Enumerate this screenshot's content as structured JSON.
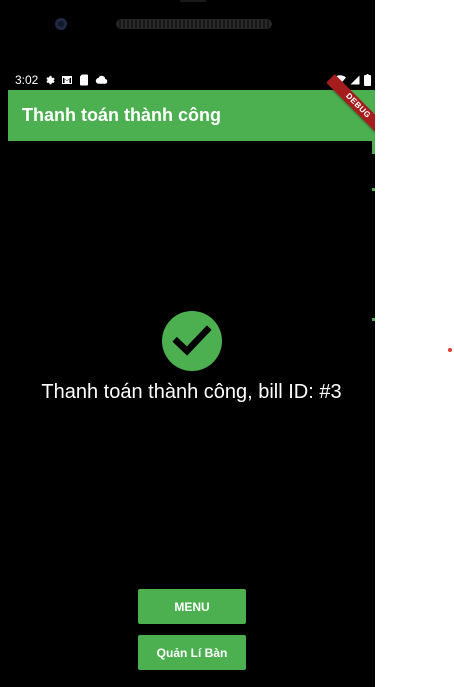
{
  "status_bar": {
    "time": "3:02",
    "left_icons": [
      "gear-icon",
      "gmail-icon",
      "sim-card-icon",
      "cloud-icon"
    ],
    "right_icons": [
      "wifi-icon",
      "signal-icon",
      "battery-icon"
    ]
  },
  "appbar": {
    "title": "Thanh toán thành công",
    "debug_banner": "DEBUG"
  },
  "content": {
    "status_icon": "check-circle-icon",
    "message": "Thanh toán thành công, bill ID: #3"
  },
  "buttons": {
    "menu": "MENU",
    "table_manager": "Quản Lí Bàn"
  },
  "colors": {
    "primary": "#4caf50",
    "background": "#000000",
    "text": "#ffffff",
    "debug": "#a61d1d"
  }
}
